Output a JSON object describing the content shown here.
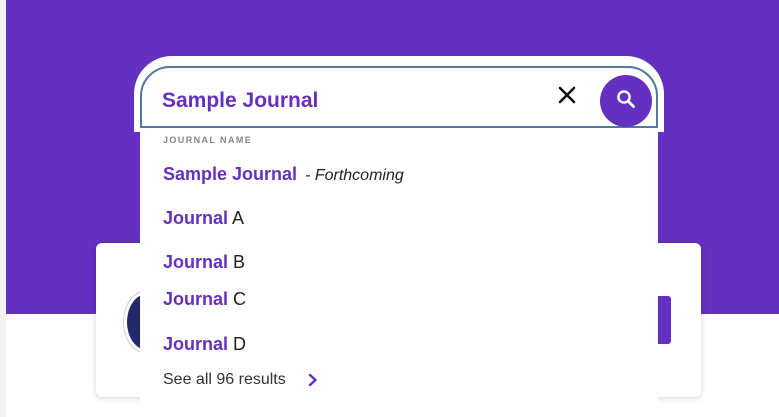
{
  "search": {
    "query": "Sample Journal",
    "clear_icon": "close-icon",
    "submit_icon": "search-icon"
  },
  "dropdown": {
    "section_label": "JOURNAL NAME",
    "results": [
      {
        "match": "Sample Journal",
        "rest": "",
        "note": "- Forthcoming"
      },
      {
        "match": "Journal",
        "rest": " A",
        "note": ""
      },
      {
        "match": "Journal",
        "rest": " B",
        "note": ""
      },
      {
        "match": "Journal",
        "rest": " C",
        "note": ""
      },
      {
        "match": "Journal",
        "rest": " D",
        "note": ""
      }
    ],
    "see_all": "See all 96 results",
    "see_all_icon": "chevron-right-icon"
  },
  "colors": {
    "brand": "#6330bf",
    "focus_border": "#4f78a5"
  }
}
